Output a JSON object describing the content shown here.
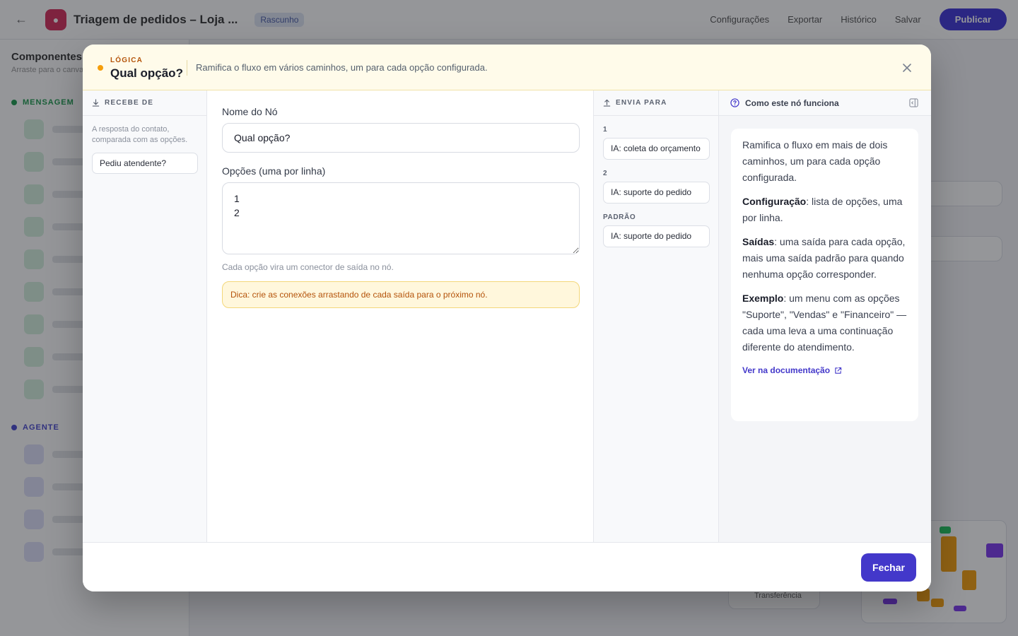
{
  "background": {
    "flow_name": "Triagem de pedidos – Loja ...",
    "flow_status": "Rascunho",
    "actions": [
      "Configurações",
      "Exportar",
      "Histórico",
      "Salvar"
    ],
    "publish_label": "Publicar",
    "sidebar_title": "Componentes",
    "sidebar_subtitle": "Arraste para o canvas",
    "section_messages": "MENSAGEM",
    "section_ai": "AGENTE",
    "mini_node_label": "Transferência"
  },
  "modal": {
    "category": "LÓGICA",
    "title": "Qual opção?",
    "description": "Ramifica o fluxo em vários caminhos, um para cada opção configurada.",
    "close_label": "Fechar"
  },
  "inputs": {
    "header": "RECEBE DE",
    "description": "A resposta do contato, comparada com as opções.",
    "source": "Pediu atendente?"
  },
  "form": {
    "name_label": "Nome do Nó",
    "name_value": "Qual opção?",
    "options_label": "Opções (uma por linha)",
    "options_value": "1\n2",
    "options_hint": "Cada opção vira um conector de saída no nó.",
    "tip": "Dica: crie as conexões arrastando de cada saída para o próximo nó."
  },
  "outputs": {
    "header": "ENVIA PARA",
    "items": [
      {
        "label": "1",
        "target": "IA: coleta do orçamento"
      },
      {
        "label": "2",
        "target": "IA: suporte do pedido"
      },
      {
        "label": "PADRÃO",
        "target": "IA: suporte do pedido"
      }
    ]
  },
  "help": {
    "title": "Como este nó funciona",
    "intro": "Ramifica o fluxo em mais de dois caminhos, um para cada opção configurada.",
    "config_term": "Configuração",
    "config_text": ": lista de opções, uma por linha.",
    "outputs_term": "Saídas",
    "outputs_text": ": uma saída para cada opção, mais uma saída padrão para quando nenhuma opção corresponder.",
    "example_term": "Exemplo",
    "example_text": ": um menu com as opções \"Suporte\", \"Vendas\" e \"Financeiro\" — cada uma leva a uma continuação diferente do atendimento.",
    "docs_link": "Ver na documentação"
  },
  "colors": {
    "accent": "#4338ca",
    "category": "#b45309",
    "header_bg": "#fffbea",
    "tip_bg": "#fff7dc"
  }
}
